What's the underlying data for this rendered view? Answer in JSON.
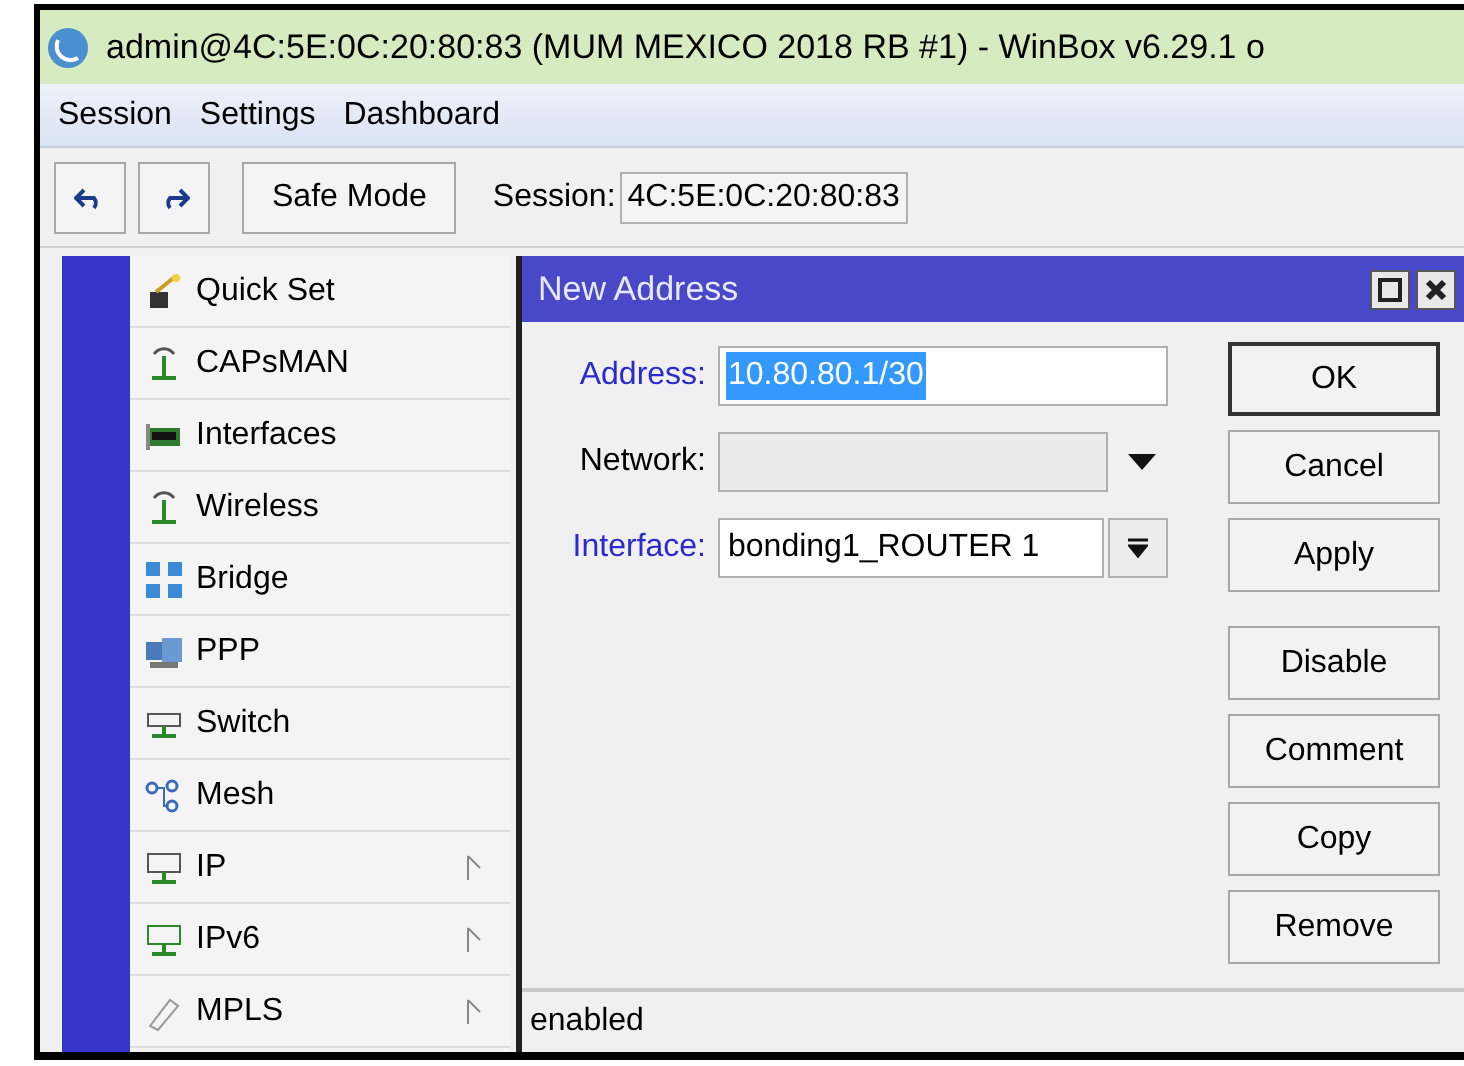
{
  "window": {
    "title": "admin@4C:5E:0C:20:80:83 (MUM MEXICO 2018 RB #1) - WinBox v6.29.1 o"
  },
  "menu": [
    "Session",
    "Settings",
    "Dashboard"
  ],
  "toolbar": {
    "safe_mode": "Safe Mode",
    "session_label": "Session:",
    "session_value": "4C:5E:0C:20:80:83"
  },
  "sidebar": {
    "items": [
      {
        "label": "Quick Set",
        "submenu": false
      },
      {
        "label": "CAPsMAN",
        "submenu": false
      },
      {
        "label": "Interfaces",
        "submenu": false
      },
      {
        "label": "Wireless",
        "submenu": false
      },
      {
        "label": "Bridge",
        "submenu": false
      },
      {
        "label": "PPP",
        "submenu": false
      },
      {
        "label": "Switch",
        "submenu": false
      },
      {
        "label": "Mesh",
        "submenu": false
      },
      {
        "label": "IP",
        "submenu": true
      },
      {
        "label": "IPv6",
        "submenu": true
      },
      {
        "label": "MPLS",
        "submenu": true
      }
    ]
  },
  "dialog": {
    "title": "New Address",
    "fields": [
      {
        "kind": "text",
        "label": "Address:",
        "value": "10.80.80.1/30",
        "required": true,
        "text_selected": true
      },
      {
        "kind": "dropdown",
        "label": "Network:",
        "required": false
      },
      {
        "kind": "combo",
        "label": "Interface:",
        "value": "bonding1_ROUTER 1",
        "required": true,
        "text_selected": false
      }
    ],
    "buttons": [
      {
        "label": "OK",
        "default": true
      },
      {
        "label": "Cancel",
        "default": false
      },
      {
        "label": "Apply",
        "default": false
      },
      {
        "label": "Disable",
        "default": false
      },
      {
        "label": "Comment",
        "default": false
      },
      {
        "label": "Copy",
        "default": false
      },
      {
        "label": "Remove",
        "default": false
      }
    ],
    "status": "enabled"
  }
}
